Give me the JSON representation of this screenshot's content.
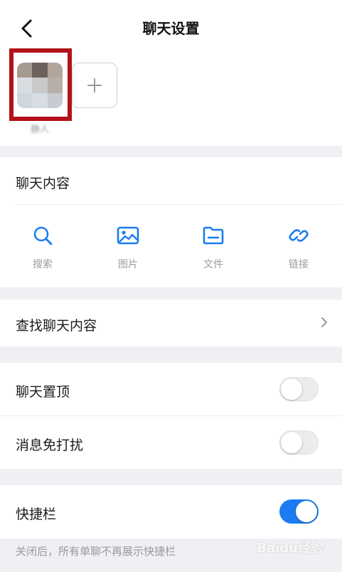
{
  "nav": {
    "title": "聊天设置"
  },
  "members": {
    "name": "静人",
    "avatar_colors": [
      "#a79a91",
      "#6d625b",
      "#b2a59c",
      "#d8dde1",
      "#c9c9cc",
      "#b7b0a9",
      "#cfd7de",
      "#d7dde3",
      "#c6ccd2"
    ],
    "highlight_color": "#b3121b"
  },
  "chat_content": {
    "header": "聊天内容",
    "categories": [
      {
        "label": "搜索",
        "icon": "search-icon"
      },
      {
        "label": "图片",
        "icon": "image-icon"
      },
      {
        "label": "文件",
        "icon": "folder-icon"
      },
      {
        "label": "链接",
        "icon": "link-icon"
      }
    ],
    "accent_color": "#1a7cf0"
  },
  "find_row": {
    "label": "查找聊天内容"
  },
  "toggles": [
    {
      "label": "聊天置顶",
      "on": false
    },
    {
      "label": "消息免打扰",
      "on": false
    }
  ],
  "shortcut": {
    "label": "快捷栏",
    "on": true,
    "hint": "关闭后，所有单聊不再展示快捷栏"
  },
  "watermark": "Baidu经验"
}
